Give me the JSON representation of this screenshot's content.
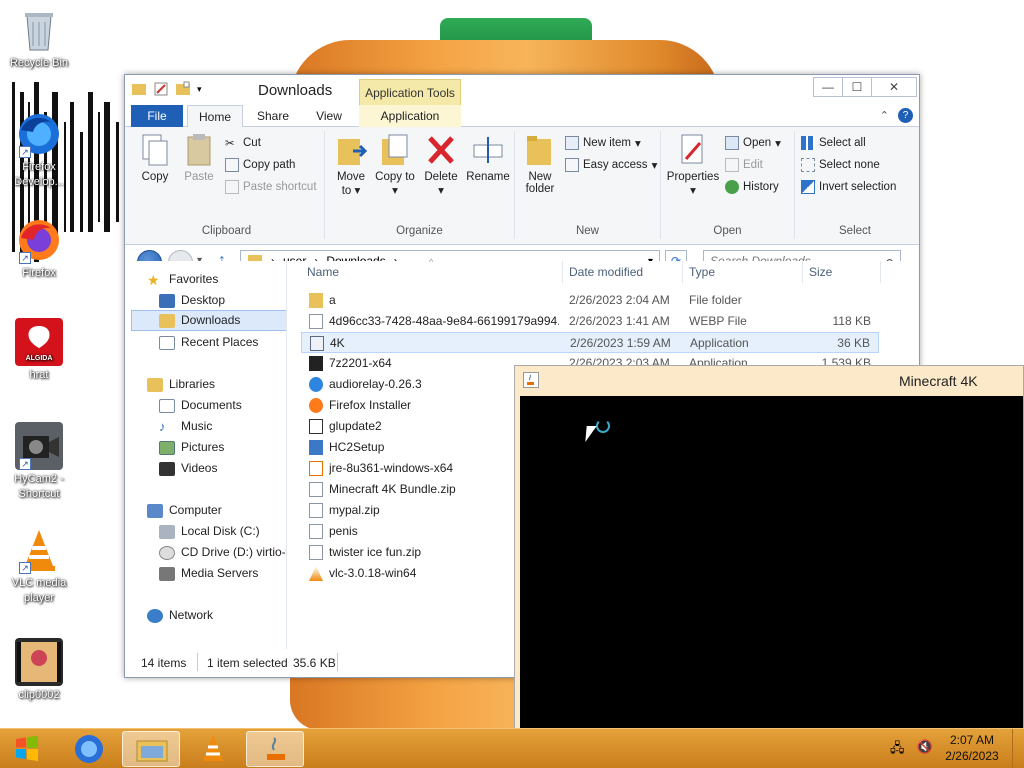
{
  "desktop": {
    "icons": [
      {
        "label": "Recycle Bin",
        "icon": "recycle-bin-icon"
      },
      {
        "label": "Firefox Develop...",
        "icon": "firefox-developer-icon"
      },
      {
        "label": "Firefox",
        "icon": "firefox-icon"
      },
      {
        "label": "hrat",
        "icon": "algida-logo-icon",
        "logo_text": "ALGIDA"
      },
      {
        "label": "HyCam2 - Shortcut",
        "icon": "hycam-icon"
      },
      {
        "label": "VLC media player",
        "icon": "vlc-icon"
      },
      {
        "label": "clip0002",
        "icon": "video-clip-icon"
      }
    ]
  },
  "explorer": {
    "title": "Downloads",
    "contextual_tab": "Application Tools",
    "tabs": [
      "File",
      "Home",
      "Share",
      "View",
      "Application"
    ],
    "ribbon": {
      "clipboard": {
        "label": "Clipboard",
        "copy": "Copy",
        "paste": "Paste",
        "cut": "Cut",
        "copy_path": "Copy path",
        "paste_shortcut": "Paste shortcut"
      },
      "organize": {
        "label": "Organize",
        "move_to": "Move to",
        "copy_to": "Copy to",
        "delete": "Delete",
        "rename": "Rename"
      },
      "new": {
        "label": "New",
        "new_folder": "New folder",
        "new_item": "New item",
        "easy_access": "Easy access"
      },
      "open": {
        "label": "Open",
        "properties": "Properties",
        "open": "Open",
        "edit": "Edit",
        "history": "History"
      },
      "select": {
        "label": "Select",
        "select_all": "Select all",
        "select_none": "Select none",
        "invert_selection": "Invert selection"
      }
    },
    "address": {
      "crumbs": [
        "user",
        "Downloads"
      ]
    },
    "search_placeholder": "Search Downloads",
    "nav": {
      "favorites": "Favorites",
      "desktop": "Desktop",
      "downloads": "Downloads",
      "recent_places": "Recent Places",
      "libraries": "Libraries",
      "documents": "Documents",
      "music": "Music",
      "pictures": "Pictures",
      "videos": "Videos",
      "computer": "Computer",
      "local_disk": "Local Disk (C:)",
      "cd_drive": "CD Drive (D:) virtio-w",
      "media_servers": "Media Servers",
      "network": "Network"
    },
    "columns": {
      "name": "Name",
      "date": "Date modified",
      "type": "Type",
      "size": "Size"
    },
    "files": [
      {
        "name": "a",
        "date": "2/26/2023 2:04 AM",
        "type": "File folder",
        "size": "",
        "icon": "folder-icon"
      },
      {
        "name": "4d96cc33-7428-48aa-9e84-66199179a994...",
        "date": "2/26/2023 1:41 AM",
        "type": "WEBP File",
        "size": "118 KB",
        "icon": "file-icon"
      },
      {
        "name": "4K",
        "date": "2/26/2023 1:59 AM",
        "type": "Application",
        "size": "36 KB",
        "icon": "app-icon"
      },
      {
        "name": "7z2201-x64",
        "date": "2/26/2023 2:03 AM",
        "type": "Application",
        "size": "1,539 KB",
        "icon": "7zip-icon"
      },
      {
        "name": "audiorelay-0.26.3",
        "date": "",
        "type": "",
        "size": "",
        "icon": "audiorelay-icon"
      },
      {
        "name": "Firefox Installer",
        "date": "",
        "type": "",
        "size": "",
        "icon": "firefox-icon"
      },
      {
        "name": "glupdate2",
        "date": "",
        "type": "",
        "size": "",
        "icon": "glupdate-icon"
      },
      {
        "name": "HC2Setup",
        "date": "",
        "type": "",
        "size": "",
        "icon": "installer-icon"
      },
      {
        "name": "jre-8u361-windows-x64",
        "date": "",
        "type": "",
        "size": "",
        "icon": "java-icon"
      },
      {
        "name": "Minecraft 4K Bundle.zip",
        "date": "",
        "type": "",
        "size": "",
        "icon": "zip-icon"
      },
      {
        "name": "mypal.zip",
        "date": "",
        "type": "",
        "size": "",
        "icon": "zip-icon"
      },
      {
        "name": "penis",
        "date": "",
        "type": "",
        "size": "",
        "icon": "file-icon"
      },
      {
        "name": "twister ice fun.zip",
        "date": "",
        "type": "",
        "size": "",
        "icon": "zip-icon"
      },
      {
        "name": "vlc-3.0.18-win64",
        "date": "",
        "type": "",
        "size": "",
        "icon": "vlc-icon"
      }
    ],
    "status": {
      "count": "14 items",
      "selected": "1 item selected",
      "size": "35.6 KB"
    }
  },
  "minecraft_window": {
    "title": "Minecraft 4K"
  },
  "taskbar": {
    "items": [
      "windows-start-icon",
      "firefox-icon",
      "file-explorer-icon",
      "vlc-icon",
      "java-icon"
    ],
    "clock_time": "2:07 AM",
    "clock_date": "2/26/2023"
  },
  "colors": {
    "accent": "#1f5fb5",
    "taskbar": "#d48c2a",
    "contextual_tab": "#f4e9a9"
  }
}
